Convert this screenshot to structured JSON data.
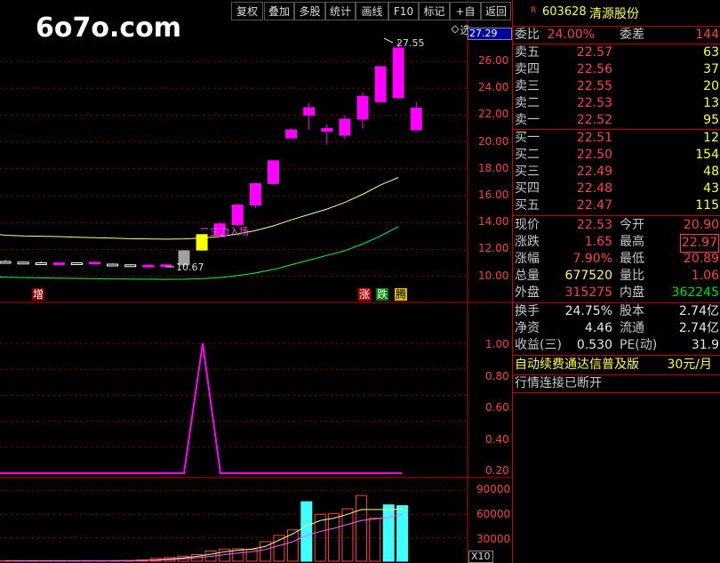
{
  "watermark": "6o7o.com",
  "toolbar": [
    "复权",
    "叠加",
    "多股",
    "统计",
    "画线",
    "F10",
    "标记",
    "+自选",
    "返回"
  ],
  "stock": {
    "marker": "R",
    "code": "603628",
    "name": "清源股份"
  },
  "price_axis": {
    "top_box": "27.29",
    "ticks": [
      "26.00",
      "24.00",
      "22.00",
      "20.00",
      "18.00",
      "16.00",
      "14.00",
      "12.00",
      "10.00"
    ]
  },
  "indicator_axis": {
    "ticks": [
      "1.00",
      "0.80",
      "0.60",
      "0.40",
      "0.20"
    ]
  },
  "volume_axis": {
    "ticks": [
      "90000",
      "60000",
      "30000"
    ],
    "unit": "X10"
  },
  "annotations": {
    "high": "27.55",
    "low": "10.67",
    "event": "主力入场",
    "bottom_left": "增",
    "legend_zhang": "涨",
    "legend_die": "跌",
    "legend_teng": "腾"
  },
  "quote": {
    "weibi_label": "委比",
    "weibi": "24.00%",
    "weicha_label": "委差",
    "weicha": "144",
    "asks": [
      {
        "label": "卖五",
        "price": "22.57",
        "vol": "63"
      },
      {
        "label": "卖四",
        "price": "22.56",
        "vol": "37"
      },
      {
        "label": "卖三",
        "price": "22.55",
        "vol": "20"
      },
      {
        "label": "卖二",
        "price": "22.53",
        "vol": "13"
      },
      {
        "label": "卖一",
        "price": "22.52",
        "vol": "95"
      }
    ],
    "bids": [
      {
        "label": "买一",
        "price": "22.51",
        "vol": "12"
      },
      {
        "label": "买二",
        "price": "22.50",
        "vol": "154"
      },
      {
        "label": "买三",
        "price": "22.49",
        "vol": "48"
      },
      {
        "label": "买四",
        "price": "22.48",
        "vol": "43"
      },
      {
        "label": "买五",
        "price": "22.47",
        "vol": "115"
      }
    ],
    "stats": [
      {
        "l1": "现价",
        "v1": "22.53",
        "c1": "red",
        "l2": "今开",
        "v2": "20.90",
        "c2": "red"
      },
      {
        "l1": "涨跌",
        "v1": "1.65",
        "c1": "red",
        "l2": "最高",
        "v2": "22.97",
        "c2": "red"
      },
      {
        "l1": "涨幅",
        "v1": "7.90%",
        "c1": "red",
        "l2": "最低",
        "v2": "20.89",
        "c2": "red"
      },
      {
        "l1": "总量",
        "v1": "677520",
        "c1": "yellow",
        "l2": "量比",
        "v2": "1.06",
        "c2": "red"
      },
      {
        "l1": "外盘",
        "v1": "315275",
        "c1": "red",
        "l2": "内盘",
        "v2": "362245",
        "c2": "green"
      }
    ],
    "fund": [
      {
        "l1": "换手",
        "v1": "24.75%",
        "l2": "股本",
        "v2": "2.74亿"
      },
      {
        "l1": "净资",
        "v1": "4.46",
        "l2": "流通",
        "v2": "2.74亿"
      },
      {
        "l1": "收益(三)",
        "v1": "0.530",
        "l2": "PE(动)",
        "v2": "31.9"
      }
    ],
    "promo": "自动续费通达信普及版",
    "price_tag": "30元/月",
    "status": "行情连接已断开"
  },
  "colors": {
    "up": "#ff00ff",
    "down": "#ffffff",
    "ma1": "#ffff80",
    "ma2": "#00ff40",
    "grid": "#8b0000"
  },
  "chart_data": {
    "type": "candlestick",
    "candles": [
      [
        11.1,
        11.05,
        11.2,
        10.95
      ],
      [
        11.05,
        11.0,
        11.1,
        10.95
      ],
      [
        11.0,
        10.95,
        11.1,
        10.9
      ],
      [
        10.98,
        11.0,
        11.05,
        10.95
      ],
      [
        11.0,
        10.97,
        11.05,
        10.9
      ],
      [
        11.0,
        11.05,
        11.1,
        10.95
      ],
      [
        10.9,
        10.85,
        10.95,
        10.8
      ],
      [
        10.85,
        10.8,
        10.9,
        10.75
      ],
      [
        10.8,
        10.82,
        10.9,
        10.75
      ],
      [
        10.8,
        10.85,
        10.9,
        10.75
      ],
      [
        11.9,
        10.85,
        11.95,
        10.67
      ],
      [
        11.95,
        13.1,
        13.1,
        11.9
      ],
      [
        13.05,
        13.9,
        14.0,
        12.9
      ],
      [
        13.85,
        15.3,
        15.4,
        13.7
      ],
      [
        15.3,
        16.9,
        16.9,
        15.1
      ],
      [
        16.9,
        18.6,
        18.6,
        16.8
      ],
      [
        20.3,
        20.9,
        21.0,
        20.3
      ],
      [
        22.0,
        22.55,
        22.9,
        20.9
      ],
      [
        20.8,
        21.0,
        21.3,
        19.8
      ],
      [
        20.5,
        21.7,
        22.0,
        20.2
      ],
      [
        21.7,
        23.4,
        23.7,
        21.0
      ],
      [
        23.0,
        25.6,
        25.7,
        22.9
      ],
      [
        23.3,
        27.0,
        27.55,
        23.2
      ],
      [
        20.9,
        22.53,
        22.97,
        20.89
      ]
    ],
    "ma1": [
      13.1,
      13.05,
      13.0,
      12.98,
      12.95,
      12.9,
      12.87,
      12.84,
      12.8,
      12.78,
      12.76,
      12.78,
      12.85,
      12.95,
      13.15,
      13.4,
      13.75,
      14.2,
      14.6,
      15.0,
      15.5,
      16.1,
      16.8,
      17.35
    ],
    "ma2": [
      9.95,
      9.93,
      9.9,
      9.88,
      9.86,
      9.84,
      9.82,
      9.8,
      9.79,
      9.78,
      9.77,
      9.78,
      9.82,
      9.9,
      10.05,
      10.25,
      10.5,
      10.85,
      11.2,
      11.55,
      11.9,
      12.4,
      13.0,
      13.7
    ],
    "indicator": [
      0,
      0,
      0,
      0,
      0,
      0,
      0,
      0,
      0,
      0,
      0,
      0,
      0,
      0,
      0,
      0,
      1,
      0,
      0,
      0,
      0,
      0,
      0,
      0,
      0,
      0,
      0,
      0,
      0,
      0
    ],
    "volume": [
      600,
      500,
      700,
      650,
      500,
      400,
      600,
      500,
      700,
      800,
      1500,
      3500,
      4800,
      6500,
      8500,
      13000,
      15500,
      16000,
      15000,
      25000,
      33000,
      40000,
      76000,
      60000,
      61000,
      67000,
      84000,
      55000,
      72000,
      71000
    ],
    "vol_ma1": [
      500,
      520,
      550,
      580,
      560,
      540,
      560,
      590,
      640,
      700,
      1000,
      1700,
      2900,
      4300,
      6300,
      9000,
      12000,
      14000,
      15500,
      19000,
      27000,
      35000,
      45000,
      52000,
      55000,
      60000,
      66000,
      66000,
      66000,
      67000
    ],
    "vol_ma2": [
      400,
      420,
      450,
      470,
      480,
      490,
      500,
      520,
      550,
      600,
      800,
      1300,
      2000,
      3000,
      4400,
      6200,
      8400,
      10400,
      12000,
      15000,
      20000,
      25000,
      33000,
      38000,
      42000,
      47000,
      52000,
      54000,
      56000,
      60000
    ]
  }
}
